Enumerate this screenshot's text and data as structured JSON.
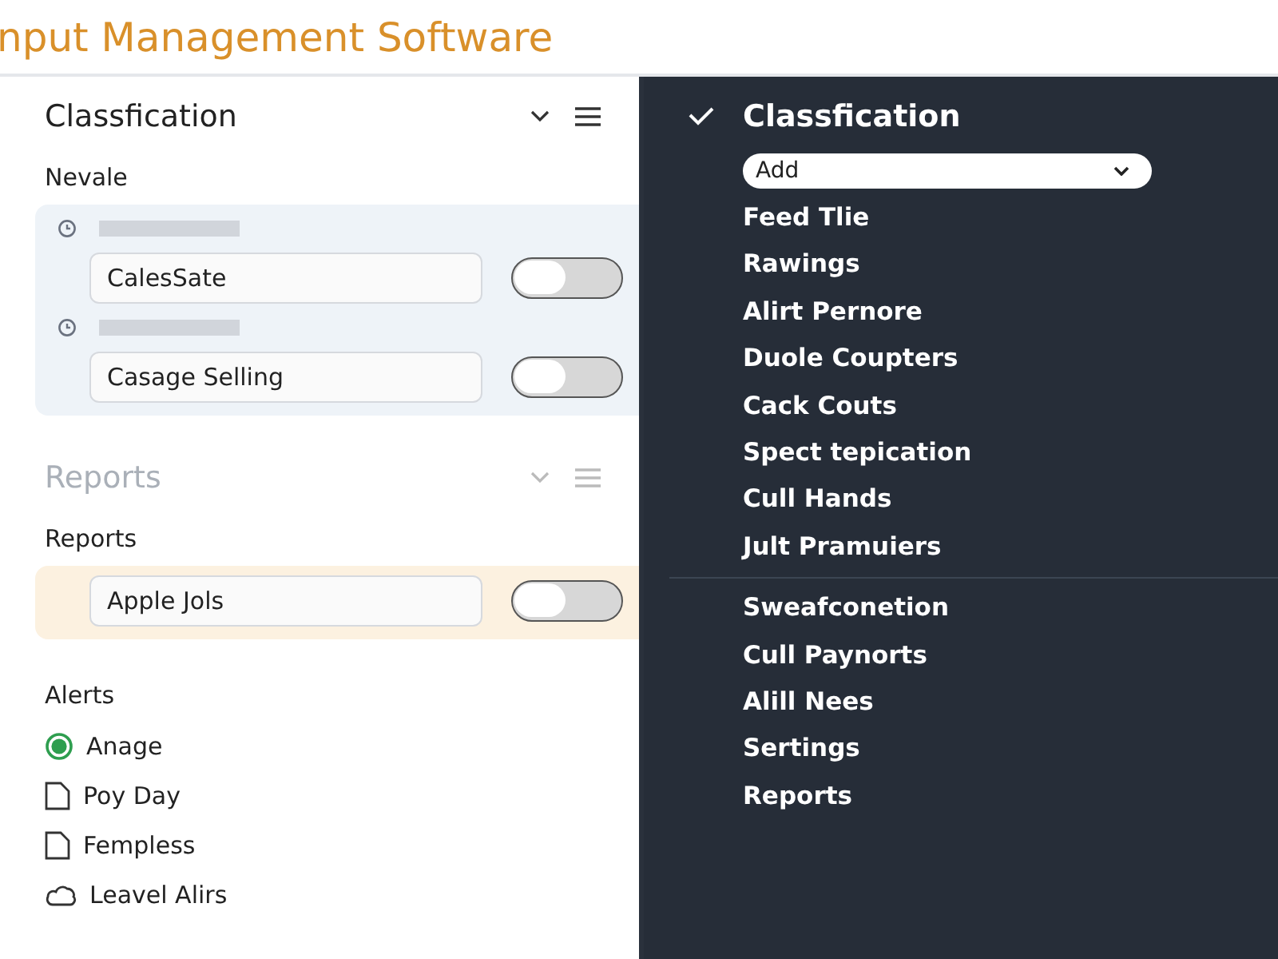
{
  "app_title": "nput Management Software",
  "left_panel": {
    "sections": [
      {
        "title": "Classfication",
        "dimmed": false,
        "label": "Nevale",
        "color": "#eef3f8",
        "rows": [
          {
            "kind": "timed",
            "value": "CalesSate",
            "on": false
          },
          {
            "kind": "timed",
            "value": "Casage Selling",
            "on": false
          }
        ]
      },
      {
        "title": "Reports",
        "dimmed": true,
        "label": "Reports",
        "color": "#fcf1e0",
        "rows": [
          {
            "kind": "plain",
            "value": "Apple Jols",
            "on": false
          }
        ]
      }
    ],
    "alerts": {
      "label": "Alerts",
      "items": [
        {
          "kind": "status",
          "label": "Anage"
        },
        {
          "kind": "document",
          "label": "Poy Day"
        },
        {
          "kind": "document",
          "label": "Fempless"
        },
        {
          "kind": "cloud",
          "label": "Leavel Alirs"
        }
      ]
    }
  },
  "right_panel": {
    "heading": "Classfication",
    "expanded": true,
    "dropdown": {
      "value": "Add"
    },
    "groups": [
      [
        "Feed Tlie",
        "Rawings",
        "Alirt Pernore",
        "Duole Coupters",
        "Cack Couts",
        "Spect tepication",
        "Cull Hands",
        "Jult Pramuiers"
      ],
      [
        "Sweafconetion",
        "Cull Paynorts",
        "Alill Nees",
        "Sertings",
        "Reports"
      ]
    ]
  }
}
